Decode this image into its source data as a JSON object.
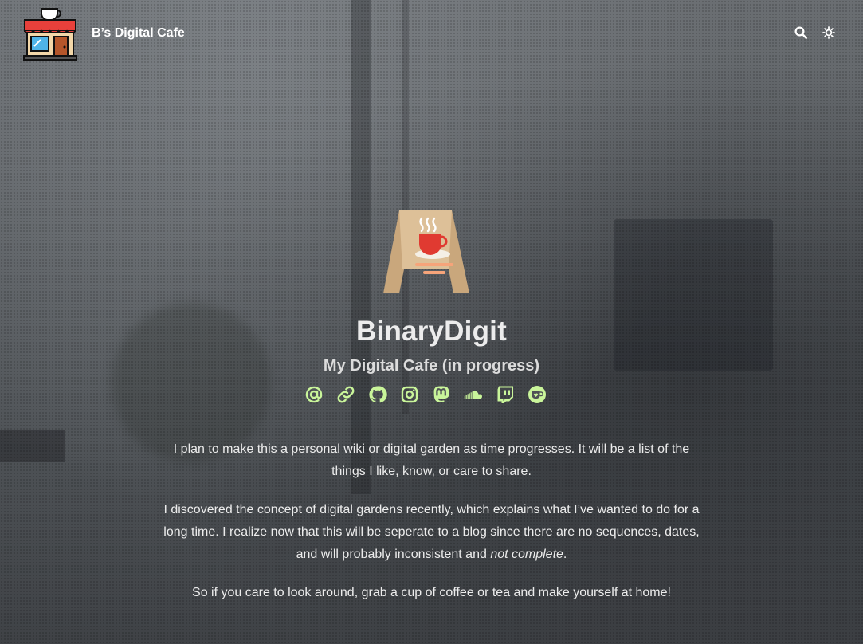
{
  "site": {
    "title": "B’s Digital Cafe"
  },
  "header": {
    "search_icon": "search-icon",
    "theme_icon": "sun-icon"
  },
  "profile": {
    "name": "BinaryDigit",
    "tagline": "My Digital Cafe (in progress)"
  },
  "socials": [
    {
      "icon": "at-sign-icon"
    },
    {
      "icon": "link-icon"
    },
    {
      "icon": "github-icon"
    },
    {
      "icon": "instagram-icon"
    },
    {
      "icon": "mastodon-icon"
    },
    {
      "icon": "soundcloud-icon"
    },
    {
      "icon": "twitch-icon"
    },
    {
      "icon": "ko-fi-icon"
    }
  ],
  "content": {
    "p1": "I plan to make this a personal wiki or digital garden as time progresses. It will be a list of the things I like, know, or care to share.",
    "p2_before": "I discovered the concept of digital gardens recently, which explains what I’ve wanted to do for a long time. I realize now that this will be seperate to a blog since there are no sequences, dates, and will probably inconsistent and ",
    "p2_em": "not complete",
    "p2_after": ".",
    "p3": "So if you care to look around, grab a cup of coffee or tea and make yourself at home!"
  },
  "colors": {
    "accent": "#c9f59a",
    "text": "#ececec"
  }
}
